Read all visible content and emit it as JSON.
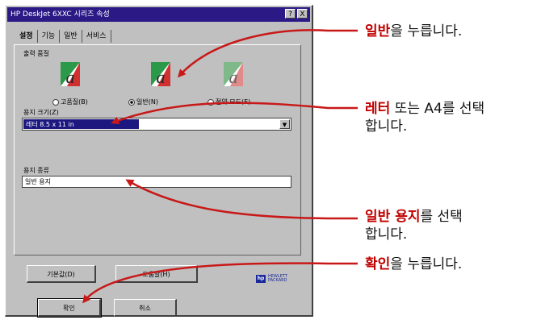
{
  "dialog": {
    "title": "HP DeskJet 6XXC 시리즈 속성",
    "title_buttons": [
      "?",
      "X"
    ],
    "tabs": [
      {
        "label": "설정",
        "active": true
      },
      {
        "label": "기능",
        "active": false
      },
      {
        "label": "일반",
        "active": false
      },
      {
        "label": "서비스",
        "active": false
      }
    ],
    "print_quality": {
      "label": "출력 품질",
      "options": [
        {
          "label": "고품질(B)",
          "selected": false
        },
        {
          "label": "일반(N)",
          "selected": true
        },
        {
          "label": "절약 모드(E)",
          "selected": false
        }
      ]
    },
    "paper_size": {
      "label": "용지 크기(Z)",
      "value": "레터 8.5 x 11 in"
    },
    "paper_type": {
      "label": "용지 종류",
      "value": "일반 용지"
    },
    "buttons": {
      "defaults": "기본값(D)",
      "help": "도움말(H)",
      "ok": "확인",
      "cancel": "취소"
    },
    "logo_text": "HEWLETT PACKARD"
  },
  "callouts": [
    {
      "highlight": "일반",
      "rest": "을 누릅니다."
    },
    {
      "highlight": "레터",
      "rest": " 또는 A4를 선택",
      "line2": "합니다."
    },
    {
      "highlight": "일반 용지",
      "rest": "를 선택",
      "line2": "합니다."
    },
    {
      "highlight": "확인",
      "rest": "을 누릅니다."
    }
  ],
  "colors": {
    "highlight": "#c00000",
    "arrow": "#c81818",
    "titlebar": "#2b1a86"
  }
}
